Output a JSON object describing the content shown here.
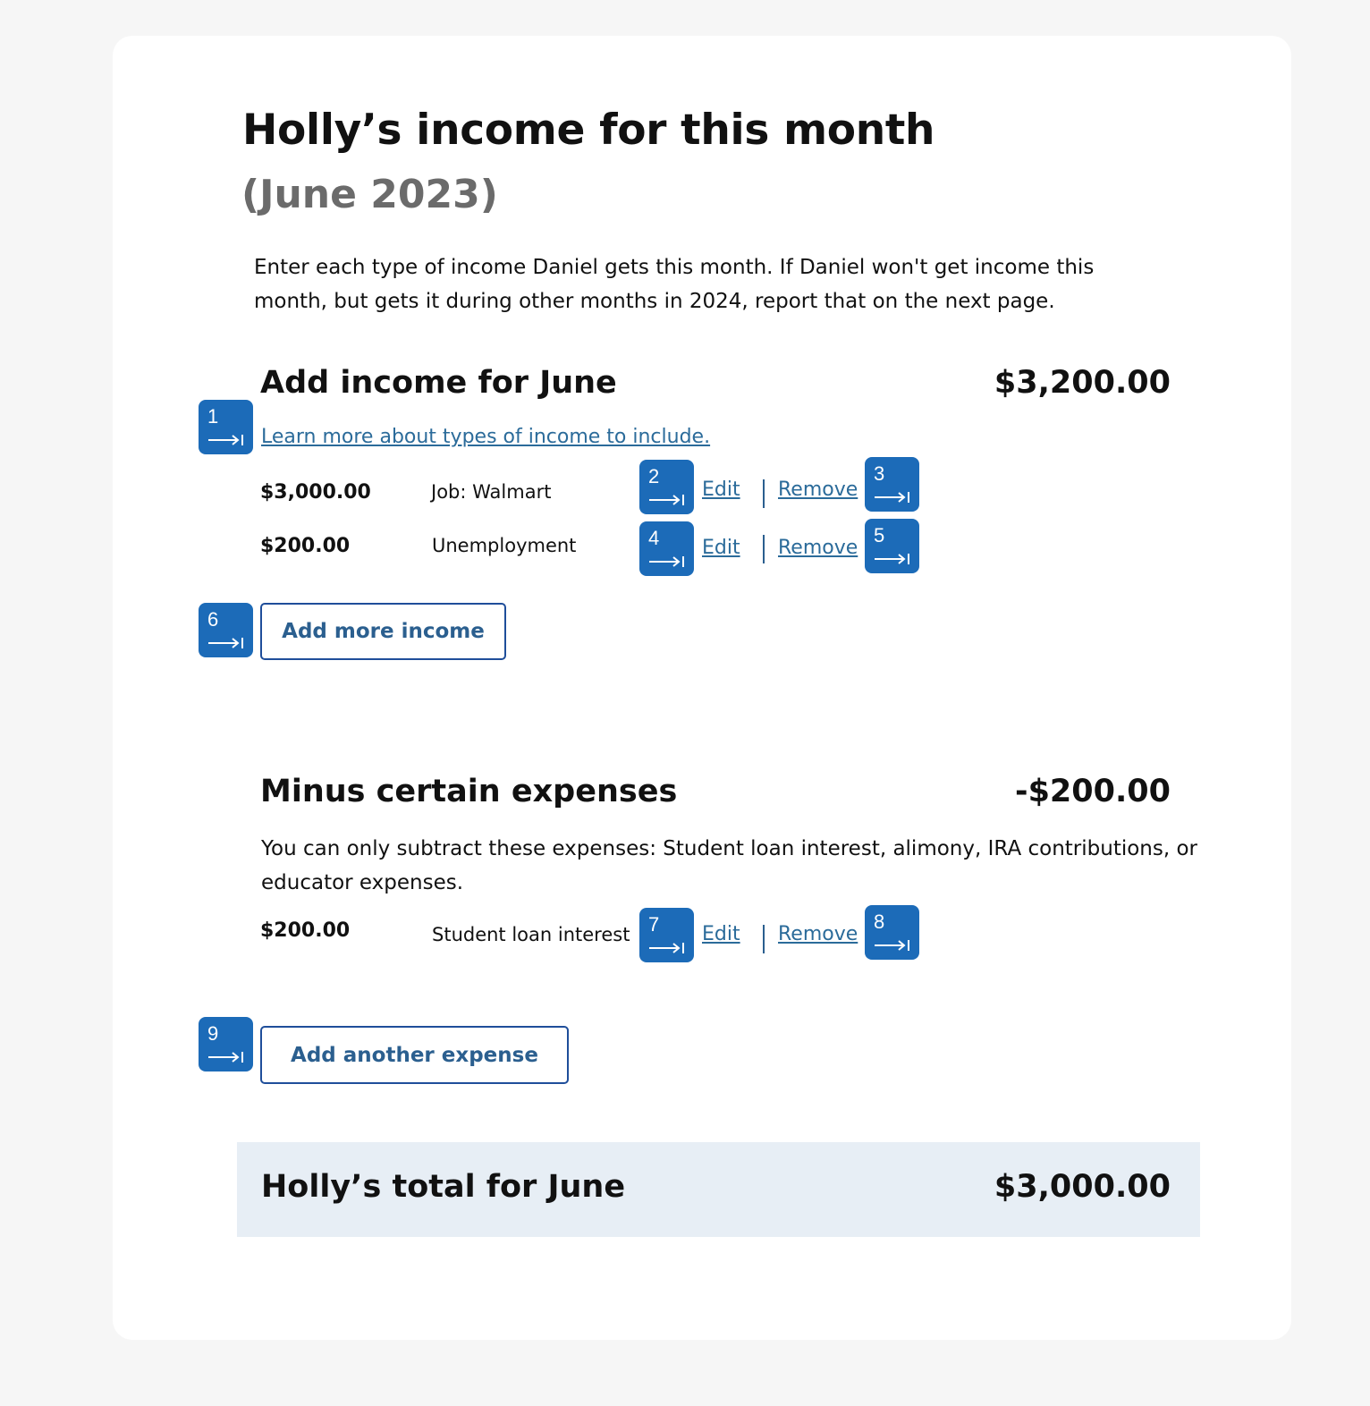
{
  "page": {
    "title": "Holly’s income for this month",
    "subtitle": "(June 2023)",
    "intro": "Enter each type of income Daniel gets this month. If Daniel won't get income this month, but gets it during other months in 2024, report that on the next page."
  },
  "income": {
    "heading": "Add income for June",
    "total": "$3,200.00",
    "learn_link": "Learn more about types of income to include.",
    "items": [
      {
        "amount": "$3,000.00",
        "description": "Job: Walmart",
        "edit": "Edit",
        "remove": "Remove"
      },
      {
        "amount": "$200.00",
        "description": "Unemployment",
        "edit": "Edit",
        "remove": "Remove"
      }
    ],
    "add_button": "Add more income"
  },
  "expenses": {
    "heading": "Minus certain expenses",
    "total": "-$200.00",
    "note": "You can only subtract these expenses: Student loan interest, alimony, IRA contributions, or educator expenses.",
    "items": [
      {
        "amount": "$200.00",
        "description": "Student loan interest",
        "edit": "Edit",
        "remove": "Remove"
      }
    ],
    "add_button": "Add another expense"
  },
  "total": {
    "label": "Holly’s total for June",
    "amount": "$3,000.00"
  },
  "tab_markers": [
    "1",
    "2",
    "3",
    "4",
    "5",
    "6",
    "7",
    "8",
    "9"
  ],
  "colors": {
    "badge": "#1c6bb8",
    "link": "#2b6b9a",
    "button_border": "#1f4e9a",
    "total_bg": "#e7eef5"
  }
}
